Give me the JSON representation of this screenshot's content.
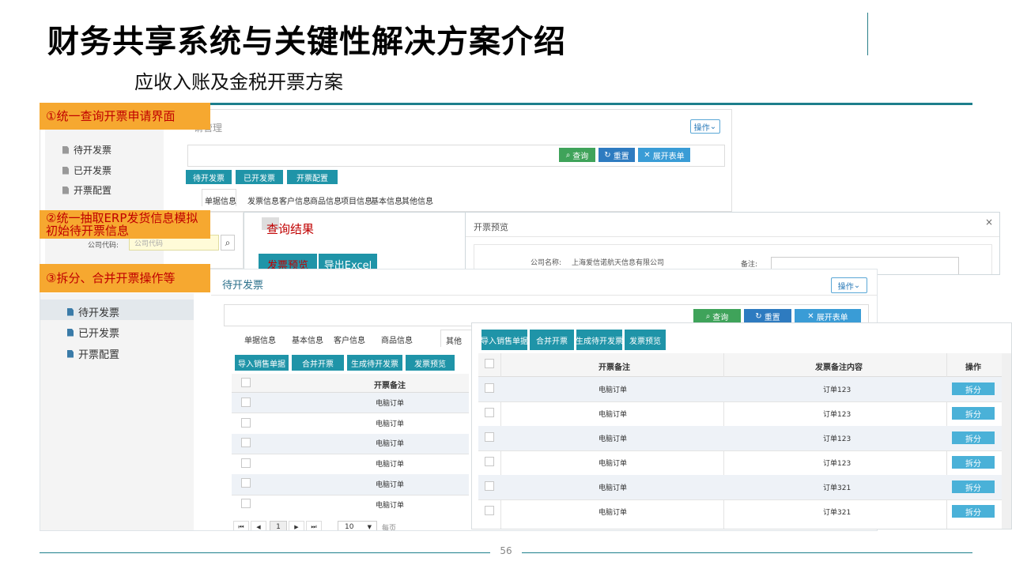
{
  "slide": {
    "title": "财务共享系统与关键性解决方案介绍",
    "subtitle": "应收入账及金税开票方案",
    "page_number": "56"
  },
  "callouts": [
    "①统一查询开票申请界面",
    "②统一抽取ERP发货信息模拟初始待开票信息",
    "③拆分、合并开票操作等"
  ],
  "panel1": {
    "header_partial": "请管理",
    "ops_button": "操作",
    "sidebar": [
      "待开发票",
      "已开发票",
      "开票配置"
    ],
    "search_buttons": [
      "查询",
      "重置",
      "展开表单"
    ],
    "tab_buttons": [
      "待开发票",
      "已开发票",
      "开票配置"
    ],
    "tabs": [
      "单据信息",
      "发票信息",
      "客户信息",
      "商品信息",
      "项目信息",
      "基本信息",
      "其他信息"
    ],
    "field_label": "公司代码:",
    "field_placeholder": "公司代码"
  },
  "panel2": {
    "title": "查询结果",
    "buttons": [
      "发票预览",
      "导出Excel"
    ]
  },
  "panel_preview": {
    "title": "开票预览",
    "close": "×",
    "company_label": "公司名称:",
    "company_value": "上海爱信诺航天信息有限公司",
    "note_label": "备注:"
  },
  "panel3": {
    "title": "待开发票",
    "ops_button": "操作",
    "sidebar": [
      "待开发票",
      "已开发票",
      "开票配置"
    ],
    "search_buttons": [
      "查询",
      "重置",
      "展开表单"
    ],
    "tabs": [
      "单据信息",
      "基本信息",
      "客户信息",
      "商品信息",
      "其他"
    ],
    "action_buttons": [
      "导入销售单据",
      "合并开票",
      "生成待开发票",
      "发票预览"
    ],
    "column": "开票备注",
    "rows": [
      "电脑订单",
      "电脑订单",
      "电脑订单",
      "电脑订单",
      "电脑订单",
      "电脑订单"
    ],
    "pager": {
      "first": "⏮",
      "prev": "◀",
      "page": "1",
      "next": "▶",
      "last": "⏭",
      "size": "10",
      "suffix": "每页"
    }
  },
  "panel4": {
    "action_buttons": [
      "导入销售单据",
      "合并开票",
      "生成待开发票",
      "发票预览"
    ],
    "columns": [
      "开票备注",
      "发票备注内容",
      "操作"
    ],
    "rows": [
      {
        "note": "电脑订单",
        "content": "订单123",
        "action": "拆分"
      },
      {
        "note": "电脑订单",
        "content": "订单123",
        "action": "拆分"
      },
      {
        "note": "电脑订单",
        "content": "订单123",
        "action": "拆分"
      },
      {
        "note": "电脑订单",
        "content": "订单123",
        "action": "拆分"
      },
      {
        "note": "电脑订单",
        "content": "订单321",
        "action": "拆分"
      },
      {
        "note": "电脑订单",
        "content": "订单321",
        "action": "拆分"
      }
    ]
  },
  "colors": {
    "teal": "#1d7f8c",
    "orange": "#f6a830",
    "callout_text": "#c00000",
    "button_teal": "#1f94a8",
    "split_button": "#4ab1d8"
  }
}
